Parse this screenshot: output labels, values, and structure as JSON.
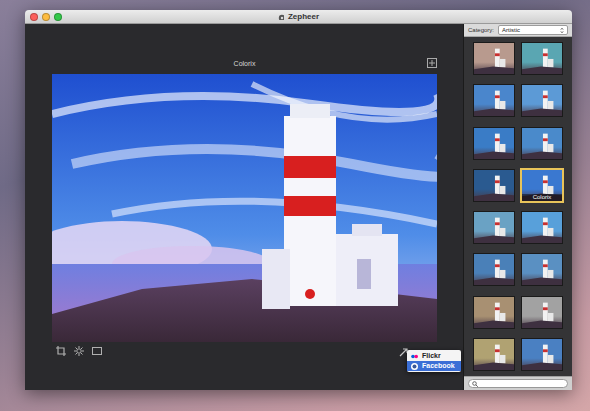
{
  "window": {
    "title": "Zepheer"
  },
  "preview": {
    "title": "Colorix"
  },
  "category": {
    "label": "Category:",
    "value": "Artistic"
  },
  "filters": [
    {
      "selected": false,
      "color": "#b89a8e"
    },
    {
      "selected": false,
      "color": "#5aa6b2"
    },
    {
      "selected": false,
      "color": "#4a86cc"
    },
    {
      "selected": false,
      "color": "#5c9ad6"
    },
    {
      "selected": false,
      "color": "#3a7cc6"
    },
    {
      "selected": false,
      "color": "#4a8acb"
    },
    {
      "selected": false,
      "color": "#2a5a90"
    },
    {
      "label": "Colorix",
      "selected": true,
      "color": "#3a78d0"
    },
    {
      "selected": false,
      "color": "#6aa2c4"
    },
    {
      "selected": false,
      "color": "#58a0da"
    },
    {
      "selected": false,
      "color": "#4a80b8"
    },
    {
      "selected": false,
      "color": "#5a90c2"
    },
    {
      "selected": false,
      "color": "#a89072"
    },
    {
      "selected": false,
      "color": "#a2a2a2"
    },
    {
      "selected": false,
      "color": "#b0a272"
    },
    {
      "selected": false,
      "color": "#4a80c2"
    }
  ],
  "share_menu": {
    "items": [
      {
        "label": "Flickr",
        "selected": false
      },
      {
        "label": "Facebook",
        "selected": true
      }
    ]
  }
}
